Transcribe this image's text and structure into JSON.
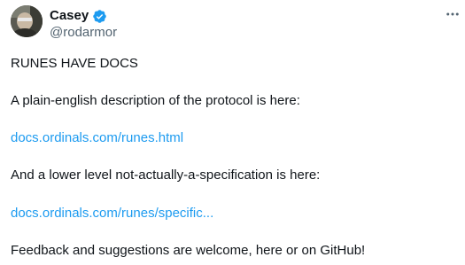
{
  "author": {
    "name": "Casey",
    "handle": "@rodarmor",
    "verified": true,
    "badge_color": "#1d9bf0"
  },
  "menu": {
    "icon": "more-horizontal-icon"
  },
  "tweet": {
    "headline": "RUNES HAVE DOCS",
    "intro": "A plain-english description of the protocol is here:",
    "link1": "docs.ordinals.com/runes.html",
    "intro2": "And a lower level not-actually-a-specification is here:",
    "link2": "docs.ordinals.com/runes/specific...",
    "closing": "Feedback and suggestions are welcome, here or on GitHub!"
  },
  "colors": {
    "text": "#0f1419",
    "secondary": "#536471",
    "link": "#1d9bf0"
  }
}
